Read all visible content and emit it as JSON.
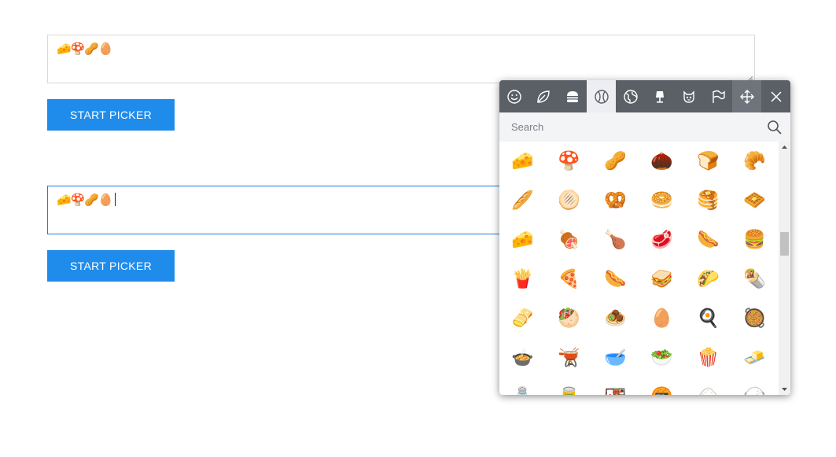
{
  "editor1": {
    "content": "🧀🍄🥜🥚"
  },
  "editor2": {
    "content": "🧀🍄🥜🥚"
  },
  "buttons": {
    "start_picker_1": "START PICKER",
    "start_picker_2": "START PICKER"
  },
  "picker": {
    "categories": [
      {
        "name": "smileys",
        "icon": "smiley-icon"
      },
      {
        "name": "nature",
        "icon": "leaf-icon"
      },
      {
        "name": "food",
        "icon": "burger-icon"
      },
      {
        "name": "activity",
        "icon": "ball-icon",
        "active": true
      },
      {
        "name": "travel",
        "icon": "globe-icon"
      },
      {
        "name": "objects",
        "icon": "lamp-icon"
      },
      {
        "name": "symbols",
        "icon": "symbol-icon"
      },
      {
        "name": "flags",
        "icon": "flag-icon"
      }
    ],
    "search_placeholder": "Search",
    "emojis": [
      [
        "🧀",
        "🍄",
        "🥜",
        "🌰",
        "🍞",
        "🥐"
      ],
      [
        "🥖",
        "🫓",
        "🥨",
        "🥯",
        "🥞",
        "🧇"
      ],
      [
        "🧀",
        "🍖",
        "🍗",
        "🥩",
        "🌭",
        "🍔"
      ],
      [
        "🍟",
        "🍕",
        "🌭",
        "🥪",
        "🌮",
        "🌯"
      ],
      [
        "🫔",
        "🥙",
        "🧆",
        "🥚",
        "🍳",
        "🥘"
      ],
      [
        "🍲",
        "🫕",
        "🥣",
        "🥗",
        "🍿",
        "🧈"
      ],
      [
        "🧂",
        "🥫",
        "🍱",
        "🍘",
        "🍙",
        "🍚"
      ]
    ],
    "colors": {
      "tab_bar": "#5b5f66",
      "active_tab": "#eceef1",
      "button": "#1f8ceb"
    }
  }
}
